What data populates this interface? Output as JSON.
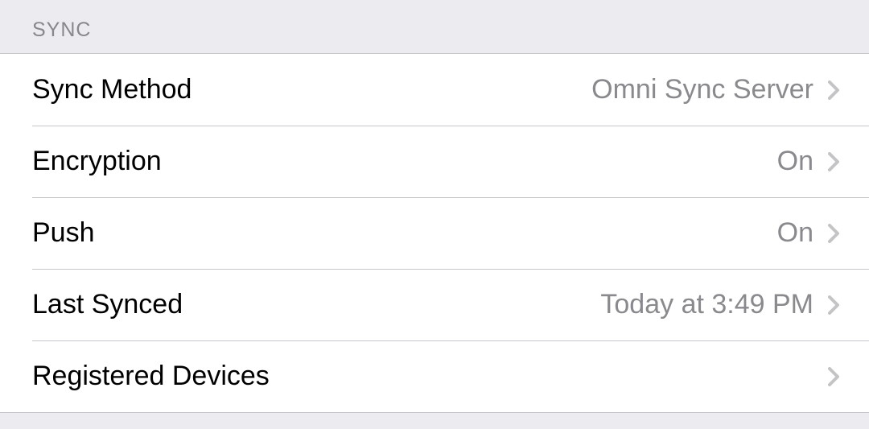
{
  "section": {
    "title": "SYNC"
  },
  "rows": [
    {
      "label": "Sync Method",
      "value": "Omni Sync Server"
    },
    {
      "label": "Encryption",
      "value": "On"
    },
    {
      "label": "Push",
      "value": "On"
    },
    {
      "label": "Last Synced",
      "value": "Today at 3:49 PM"
    },
    {
      "label": "Registered Devices",
      "value": ""
    }
  ]
}
